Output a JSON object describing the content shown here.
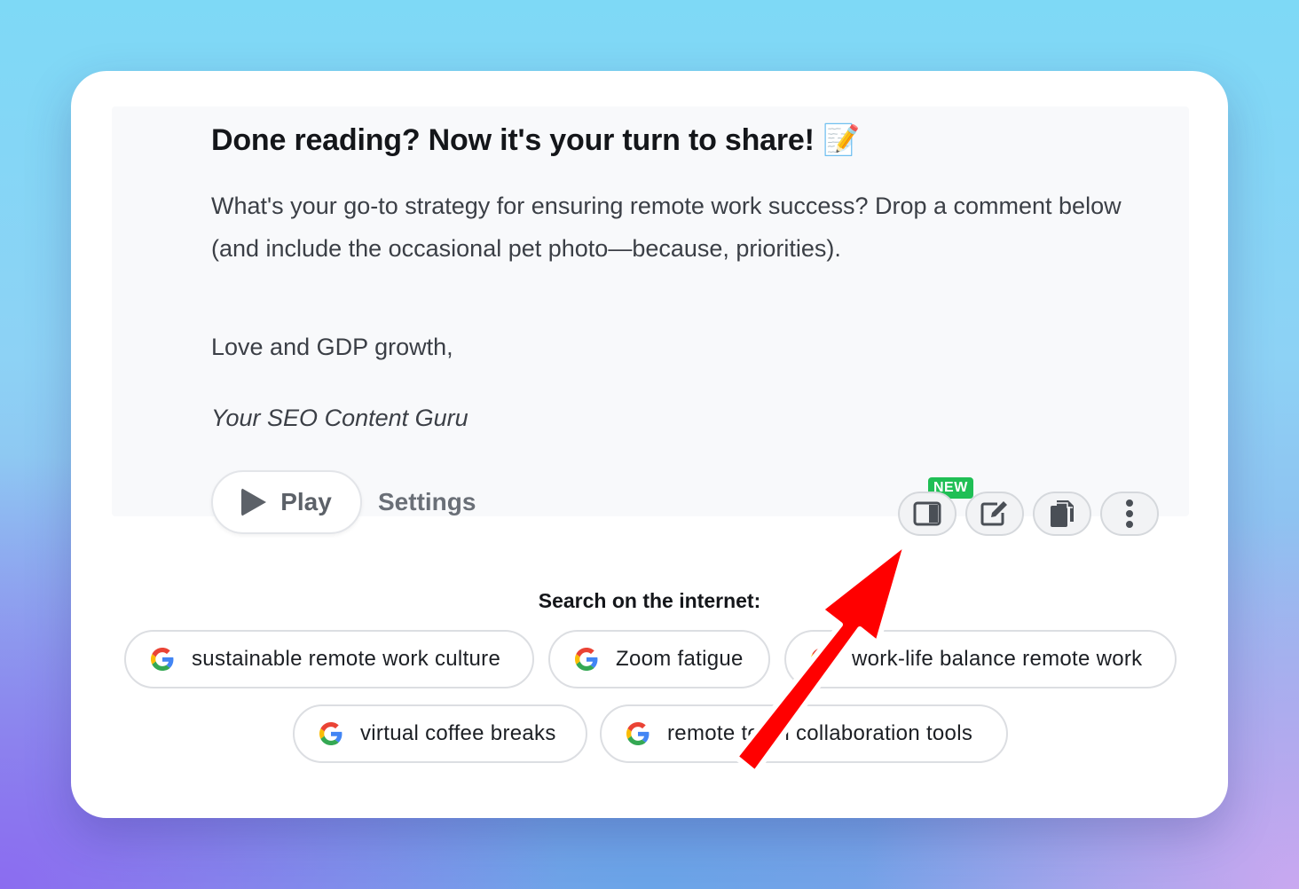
{
  "content": {
    "heading": "Done reading? Now it's your turn to share! 📝",
    "body": "What's your go-to strategy for ensuring remote work success? Drop a comment below (and include the occasional pet photo—because, priorities).",
    "signoff": "Love and GDP growth,",
    "signature": "Your SEO Content Guru"
  },
  "audio": {
    "play_label": "Play",
    "settings_label": "Settings"
  },
  "toolbar": {
    "new_badge": "NEW",
    "icons": [
      "sidebar-panel-icon",
      "edit-icon",
      "copy-icon",
      "more-vertical-icon"
    ]
  },
  "search": {
    "title": "Search on the internet:",
    "chips": [
      "sustainable remote work culture",
      "Zoom fatigue",
      "work-life balance remote work",
      "virtual coffee breaks",
      "remote team collaboration tools"
    ]
  },
  "colors": {
    "badge_green": "#1fbf55",
    "arrow_red": "#ff0000"
  }
}
